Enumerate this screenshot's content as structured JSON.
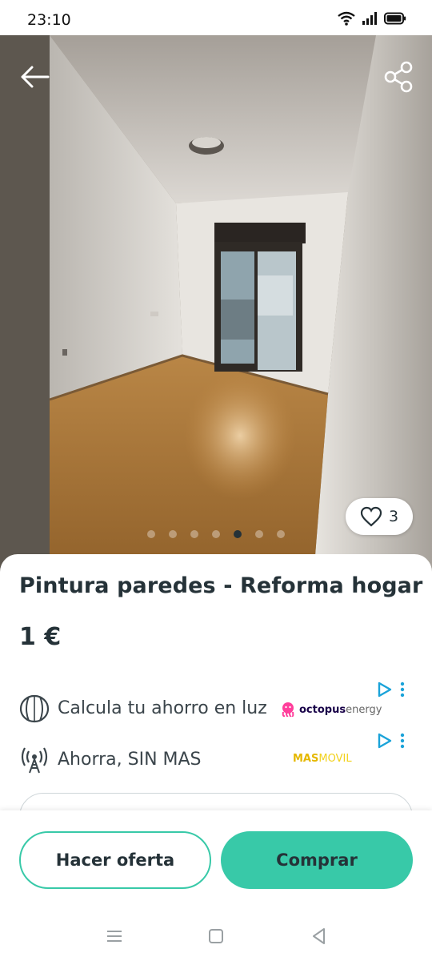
{
  "status_bar": {
    "time": "23:10"
  },
  "listing": {
    "title": "Pintura paredes - Reforma hogar",
    "price": "1 €",
    "likes_count": "3",
    "photo_count": 7,
    "active_photo_index": 4
  },
  "ads": [
    {
      "text": "Calcula tu ahorro en luz",
      "brand_a": "octopus",
      "brand_b": "energy",
      "icon": "coin-icon"
    },
    {
      "text": "Ahorra, SIN MAS",
      "brand_a": "MAS",
      "brand_b": "MOVIL",
      "icon": "antenna-icon"
    }
  ],
  "actions": {
    "offer_label": "Hacer oferta",
    "buy_label": "Comprar"
  },
  "colors": {
    "accent": "#38c9a8",
    "text": "#253238",
    "octopus_pink": "#ff3e9b",
    "masmovil_yellow": "#f2d11b"
  }
}
